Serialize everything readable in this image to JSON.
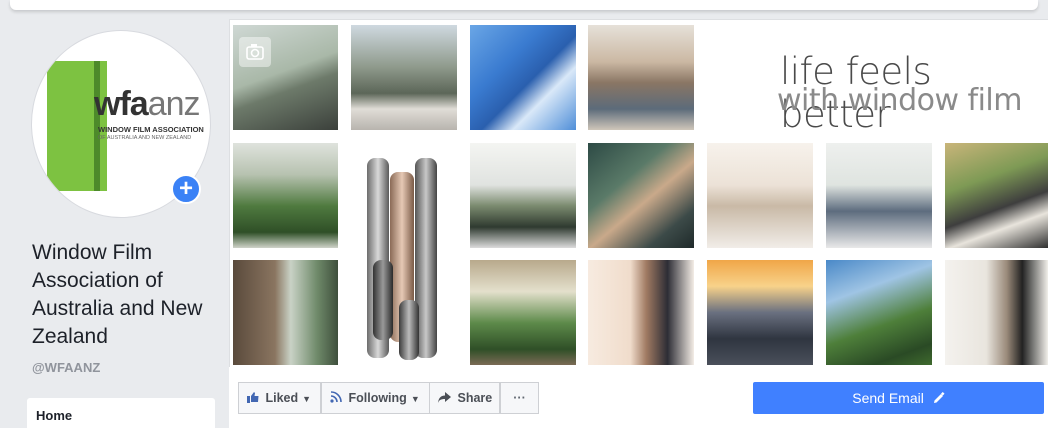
{
  "logo": {
    "brand_bold": "wfa",
    "brand_thin": "anz",
    "subtitle": "WINDOW FILM ASSOCIATION",
    "subtitle2": "OF AUSTRALIA AND NEW ZEALAND"
  },
  "page": {
    "name": "Window Film Association of Australia and New Zealand",
    "handle": "@WFAANZ"
  },
  "nav": {
    "home": "Home"
  },
  "cover": {
    "tagline_line1": "life feels better",
    "tagline_line2": "with window film"
  },
  "actions": {
    "liked": "Liked",
    "following": "Following",
    "share": "Share",
    "more": "···",
    "send_email": "Send Email"
  },
  "icons": {
    "add": "+",
    "liked": "thumbs-up-icon",
    "following": "rss-icon",
    "share": "share-arrow-icon",
    "edit": "pencil-icon",
    "camera": "camera-icon"
  },
  "colors": {
    "accent": "#4080ff",
    "link": "#4267b2",
    "logo_green": "#7dc241"
  }
}
